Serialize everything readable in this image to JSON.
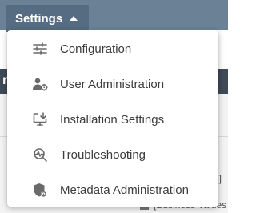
{
  "settings_button": {
    "label": "Settings",
    "icon": "caret-up-icon"
  },
  "menu": {
    "items": [
      {
        "label": "Configuration",
        "icon": "sliders-icon"
      },
      {
        "label": "User Administration",
        "icon": "user-gear-icon"
      },
      {
        "label": "Installation Settings",
        "icon": "monitor-download-icon"
      },
      {
        "label": "Troubleshooting",
        "icon": "search-pulse-icon"
      },
      {
        "label": "Metadata Administration",
        "icon": "shield-gear-icon"
      }
    ]
  },
  "background": {
    "edge_letter": "n",
    "text_a": "es]",
    "text_b": "[Business Values"
  },
  "colors": {
    "topbar": "#6b8196",
    "button": "#566c82",
    "dark_band": "#3f4a57",
    "icon": "#6a6a6a",
    "menu_text": "#3c3c3c"
  }
}
